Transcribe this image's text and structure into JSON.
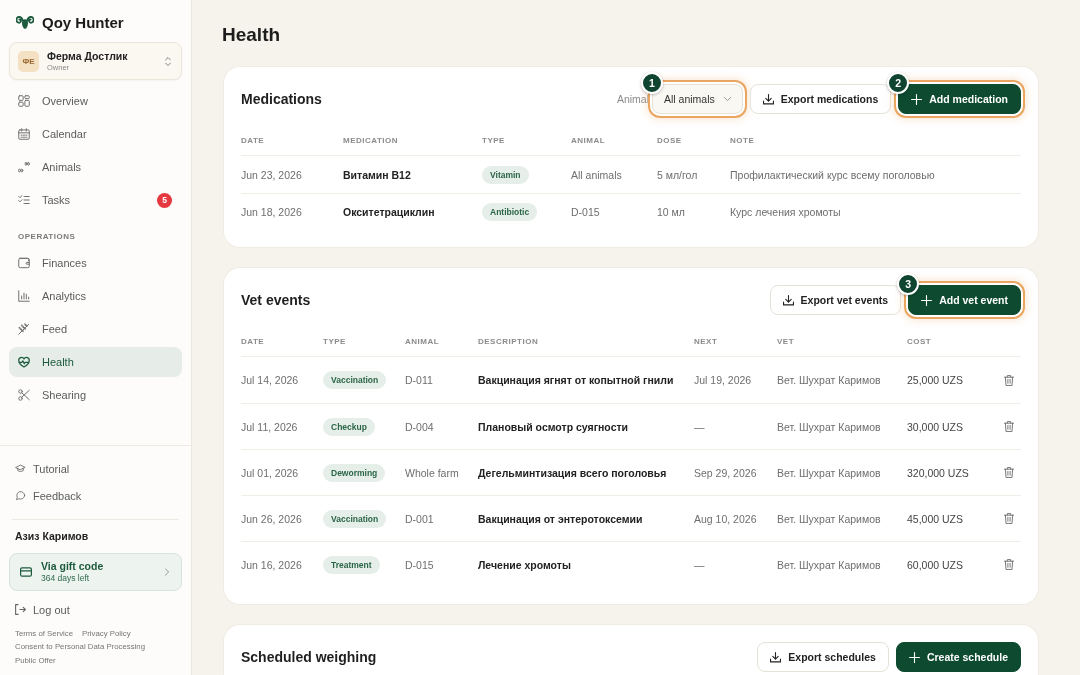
{
  "sidebar": {
    "brand": "Qoy Hunter",
    "farm": {
      "initials": "ФЕ",
      "name": "Ферма Достлик",
      "role": "Owner"
    },
    "nav_groups": [
      {
        "items": [
          {
            "label": "Overview",
            "selected": false
          },
          {
            "label": "Calendar",
            "selected": false
          },
          {
            "label": "Animals",
            "selected": false
          },
          {
            "label": "Tasks",
            "selected": false,
            "badge": "5"
          }
        ]
      },
      {
        "heading": "OPERATIONS",
        "items": [
          {
            "label": "Finances",
            "selected": false
          },
          {
            "label": "Analytics",
            "selected": false
          },
          {
            "label": "Feed",
            "selected": false
          },
          {
            "label": "Health",
            "selected": true
          },
          {
            "label": "Shearing",
            "selected": false
          }
        ]
      }
    ],
    "help_links": [
      "Tutorial",
      "Feedback"
    ],
    "user_name": "Азиз Каримов",
    "plan": {
      "title": "Via gift code",
      "subtitle": "364 days left"
    },
    "logout": "Log out",
    "legal_links": [
      "Terms of Service",
      "Privacy Policy",
      "Consent to Personal Data Processing",
      "Public Offer"
    ]
  },
  "page": {
    "title": "Health"
  },
  "medications": {
    "title": "Medications",
    "filter": {
      "label": "Animal",
      "value": "All animals",
      "highlighted": true,
      "tour_step": "1"
    },
    "buttons": [
      {
        "kind": "secondary",
        "label": "Export medications",
        "highlighted": false
      },
      {
        "kind": "primary",
        "label": "Add medication",
        "highlighted": true,
        "tour_step": "2"
      }
    ],
    "columns": [
      "DATE",
      "MEDICATION",
      "TYPE",
      "ANIMAL",
      "DOSE",
      "NOTE"
    ],
    "rows": [
      {
        "date": "Jun 23, 2026",
        "medication": "Витамин B12",
        "type": "Vitamin",
        "animal": "All animals",
        "dose": "5 мл/гол",
        "note": "Профилактический курс всему поголовью"
      },
      {
        "date": "Jun 18, 2026",
        "medication": "Окситетрациклин",
        "type": "Antibiotic",
        "animal": "D-015",
        "dose": "10 мл",
        "note": "Курс лечения хромоты"
      }
    ]
  },
  "vet_events": {
    "title": "Vet events",
    "buttons": [
      {
        "kind": "secondary",
        "label": "Export vet events",
        "highlighted": false
      },
      {
        "kind": "primary",
        "label": "Add vet event",
        "highlighted": true,
        "tour_step": "3"
      }
    ],
    "columns": [
      "DATE",
      "TYPE",
      "ANIMAL",
      "DESCRIPTION",
      "NEXT",
      "VET",
      "COST"
    ],
    "rows": [
      {
        "date": "Jul 14, 2026",
        "type": "Vaccination",
        "animal": "D-011",
        "description": "Вакцинация ягнят от копытной гнили",
        "next": "Jul 19, 2026",
        "vet": "Вет. Шухрат Каримов",
        "cost": "25,000 UZS"
      },
      {
        "date": "Jul 11, 2026",
        "type": "Checkup",
        "animal": "D-004",
        "description": "Плановый осмотр суягности",
        "next": "—",
        "vet": "Вет. Шухрат Каримов",
        "cost": "30,000 UZS"
      },
      {
        "date": "Jul 01, 2026",
        "type": "Deworming",
        "animal": "Whole farm",
        "description": "Дегельминтизация всего поголовья",
        "next": "Sep 29, 2026",
        "vet": "Вет. Шухрат Каримов",
        "cost": "320,000 UZS"
      },
      {
        "date": "Jun 26, 2026",
        "type": "Vaccination",
        "animal": "D-001",
        "description": "Вакцинация от энтеротоксемии",
        "next": "Aug 10, 2026",
        "vet": "Вет. Шухрат Каримов",
        "cost": "45,000 UZS"
      },
      {
        "date": "Jun 16, 2026",
        "type": "Treatment",
        "animal": "D-015",
        "description": "Лечение хромоты",
        "next": "—",
        "vet": "Вет. Шухрат Каримов",
        "cost": "60,000 UZS"
      }
    ]
  },
  "scheduled_weighing": {
    "title": "Scheduled weighing",
    "buttons": [
      {
        "kind": "secondary",
        "label": "Export schedules",
        "highlighted": false
      },
      {
        "kind": "primary",
        "label": "Create schedule",
        "highlighted": false
      }
    ]
  }
}
